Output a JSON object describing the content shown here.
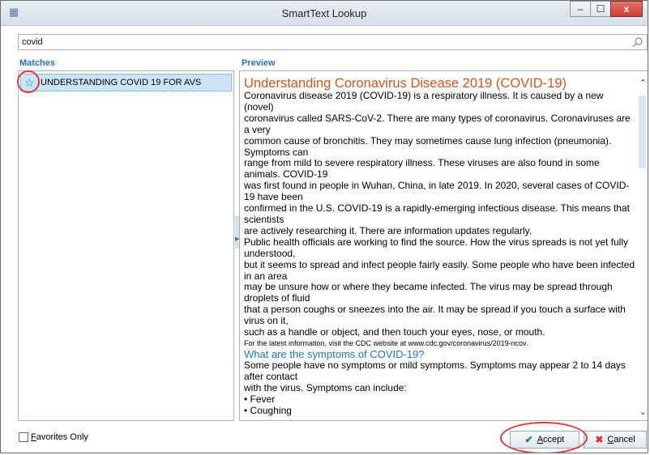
{
  "window": {
    "title": "SmartText Lookup",
    "minimize": "–",
    "maximize": "☐",
    "close": "x"
  },
  "search": {
    "value": "covid"
  },
  "matches": {
    "label": "Matches",
    "items": [
      {
        "label": "UNDERSTANDING COVID 19 FOR AVS",
        "selected": true
      }
    ]
  },
  "preview": {
    "label": "Preview",
    "title": "Understanding Coronavirus Disease 2019 (COVID-19)",
    "lines": [
      "Coronavirus disease 2019 (COVID-19) is a respiratory illness. It is caused by a new (novel)",
      "coronavirus called SARS-CoV-2. There are many types of coronavirus. Coronaviruses are a very",
      "common cause of bronchitis. They may sometimes cause lung infection (pneumonia). Symptoms can",
      "range from mild to severe respiratory illness. These viruses are also found in some animals. COVID-19",
      "was first found in people in Wuhan, China, in late 2019. In 2020, several cases of COVID-19 have been",
      "confirmed in the U.S. COVID-19 is a rapidly-emerging infectious disease. This means that scientists",
      "are actively researching it. There are information updates regularly.",
      "Public health officials are working to find the source. How the virus spreads is not yet fully understood,",
      "but it seems to spread and infect people fairly easily. Some people who have been infected in an area",
      "may be unsure how or where they became infected. The virus may be spread through droplets of fluid",
      "that a person coughs or sneezes into the air. It may be spread if you touch a surface with virus on it,",
      "such as a handle or object, and then touch your eyes, nose, or mouth."
    ],
    "small_note": "For the latest information, visit the CDC website at www.cdc.gov/coronavirus/2019-ncov.",
    "heading2": "What are the symptoms of COVID-19?",
    "lines2": [
      "Some people have no symptoms or mild symptoms. Symptoms may appear 2 to 14 days after contact",
      "with the virus. Symptoms can include:",
      "• Fever",
      "• Coughing"
    ]
  },
  "footer": {
    "favorites_label_first": "F",
    "favorites_label_rest": "avorites Only",
    "accept_first": "A",
    "accept_rest": "ccept",
    "cancel_first": "C",
    "cancel_rest": "ancel"
  },
  "colors": {
    "accent": "#2a6fbf",
    "title_orange": "#d4541c",
    "highlight_red": "#e03a3a"
  }
}
